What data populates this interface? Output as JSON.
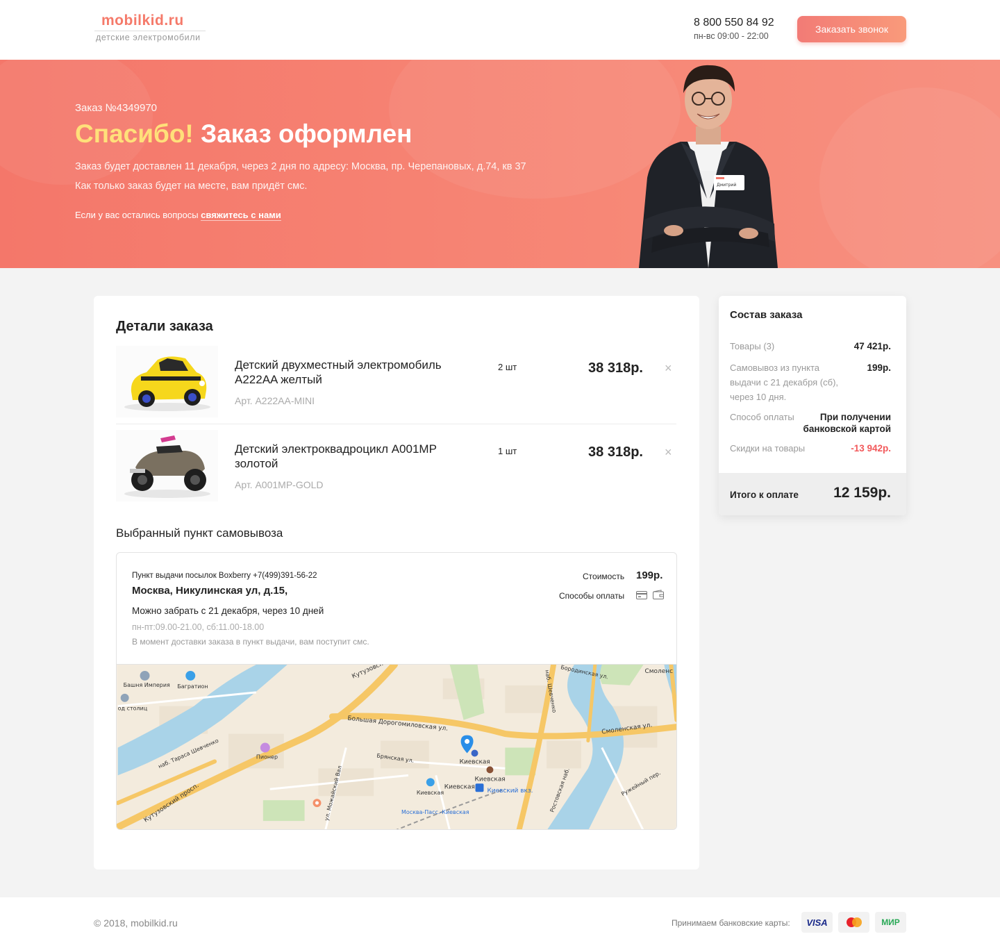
{
  "header": {
    "logo_name": "mobilkid.ru",
    "logo_tagline": "детские электромобили",
    "phone": "8 800 550 84 92",
    "hours": "пн-вс 09:00 - 22:00",
    "call_button": "Заказать звонок"
  },
  "hero": {
    "order_number": "Заказ  №4349970",
    "thanks": "Спасибо!",
    "title": "Заказ оформлен",
    "delivery_text": "Заказ будет доставлен 11 декабря, через 2 дня по адресу: Москва, пр. Черепановых, д.74, кв 37",
    "sms_text": "Как только заказ будет на месте, вам придёт смс.",
    "questions_text": "Если у вас остались вопросы",
    "contact_link": "свяжитесь с нами",
    "badge_name": "Дмитрий"
  },
  "order": {
    "title": "Детали заказа",
    "items": [
      {
        "name": "Детский двухместный электромобиль A222AA желтый",
        "sku": "Арт. A222AA-MINI",
        "qty": "2 шт",
        "price": "38 318р.",
        "image_icon": "yellow-ride-on-car-image"
      },
      {
        "name": "Детский электроквадроцикл A001MP золотой",
        "sku": "Арт. A001MP-GOLD",
        "qty": "1 шт",
        "price": "38 318р.",
        "image_icon": "atv-quad-image"
      }
    ],
    "remove_icon": "×"
  },
  "pickup": {
    "title": "Выбранный пункт самовывоза",
    "provider": "Пункт выдачи посылок Boxberry  +7(499)391-56-22",
    "address": "Москва, Никулинская ул, д.15,",
    "pickup_when": "Можно забрать с 21 декабря, через 10 дней",
    "hours": "пн-пт:09.00-21.00, сб:11.00-18.00",
    "note": "В момент доставки заказа в пункт выдачи, вам поступит смс.",
    "cost_label": "Стоимость",
    "cost": "199р.",
    "payment_label": "Способы оплаты",
    "map_labels": {
      "kutuzovskaya": "Кутузовская ул.",
      "dorogomilovskaya": "Большая Дорогомиловская ул.",
      "smolenskaya": "Смоленская ул.",
      "smolenskaya2": "Смоленс",
      "kutuzovsky": "Кутузовский просп.",
      "shevchenko_emb": "наб. Тараса Шевченко",
      "shevchenko": "наб. Шевченко",
      "kievskaya": "Киевская",
      "kievskaya2": "Киевская",
      "kievskaya3": "Киевская",
      "kievskaya4": "Киевская",
      "kievsky_vokzal": "Киевский вкз.",
      "moscow_pass": "Москва-Пасс.-Киевская",
      "pioneer": "Пионер",
      "bashnya": "Башня Империя",
      "bagration": "Багратион",
      "stolits": "од столиц",
      "bryanskaya": "Брянская ул.",
      "mozhaysky": "ул. Можайский Вал",
      "rostovskaya": "Ростовская наб.",
      "borodinskaya": "Бородинская ул.",
      "ruzhey": "Ружейный пер."
    }
  },
  "summary": {
    "title": "Состав заказа",
    "rows": [
      {
        "label": "Товары (3)",
        "value": "47 421р."
      },
      {
        "label": "Самовывоз из пункта выдачи с 21 декабря (сб), через 10 дня.",
        "value": "199р."
      },
      {
        "label": "Способ оплаты",
        "value": "При получении банковской картой"
      },
      {
        "label": "Скидки на товары",
        "value": "-13 942р."
      }
    ],
    "total_label": "Итого к оплате",
    "total": "12 159р."
  },
  "footer": {
    "copyright": "© 2018, mobilkid.ru",
    "cards_label": "Принимаем банковские карты:",
    "cards": [
      "VISA",
      "",
      "МИР"
    ]
  },
  "colors": {
    "accent": "#f4776a",
    "thanks_yellow": "#ffe07a",
    "discount_red": "#f2585a"
  }
}
